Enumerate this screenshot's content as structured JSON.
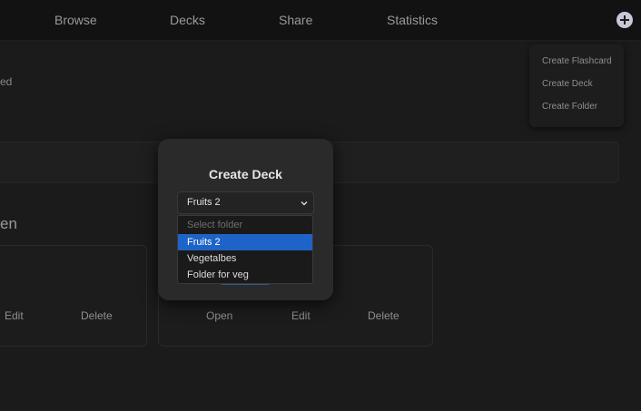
{
  "nav": {
    "items": [
      "Browse",
      "Decks",
      "Share",
      "Statistics"
    ],
    "plus_icon": "plus-circle-icon"
  },
  "create_menu": {
    "items": [
      "Create Flashcard",
      "Create Deck",
      "Create Folder"
    ]
  },
  "background": {
    "fragment_ed": "ed",
    "heading_fragment": "en",
    "card_left_actions": [
      "Edit",
      "Delete"
    ],
    "card_right_actions": [
      "Open",
      "Edit",
      "Delete"
    ]
  },
  "modal": {
    "title": "Create Deck",
    "selected_value": "Fruits 2",
    "options_placeholder": "Select folder",
    "options": [
      "Fruits 2",
      "Vegetalbes",
      "Folder for veg"
    ],
    "highlight_color": "#1e63c8"
  }
}
